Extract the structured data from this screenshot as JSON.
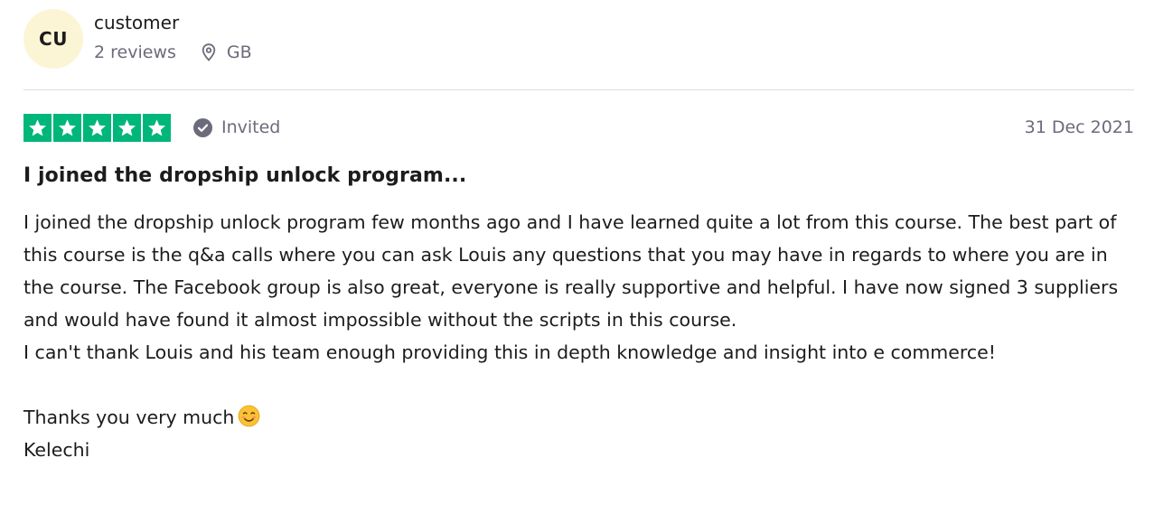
{
  "reviewer": {
    "initials": "CU",
    "name": "customer",
    "review_count": "2 reviews",
    "location": "GB",
    "avatar_color": "#fbf5d5"
  },
  "rating": {
    "stars": 5,
    "star_color": "#00b67a",
    "invited_label": "Invited",
    "date": "31 Dec 2021"
  },
  "review": {
    "title": "I joined the dropship unlock program...",
    "paragraphs": [
      "I joined the dropship unlock program few months ago and I have learned quite a lot from this course. The best part of this course is the q&a calls where you can ask Louis any questions that you may have in regards to where you are in the course. The Facebook group is also great, everyone is really supportive and helpful. I have now signed 3 suppliers and would have found it almost impossible without the scripts in this course.",
      "I can't thank Louis and his team enough providing this in depth knowledge and insight into e commerce!",
      "Thanks you very much",
      "Kelechi"
    ],
    "emoji_icon": "smiling-face-icon"
  }
}
